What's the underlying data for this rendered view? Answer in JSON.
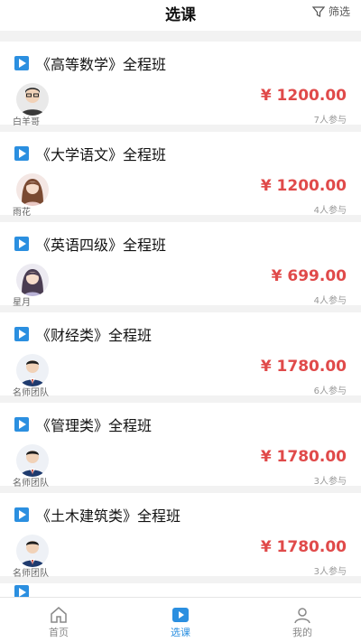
{
  "header": {
    "title": "选课",
    "filter_label": "筛选"
  },
  "courses": [
    {
      "title": "《高等数学》全程班",
      "teacher": "白羊哥",
      "price": "¥ 1200.00",
      "enrolled": "7人参与",
      "avatar": "male-glasses"
    },
    {
      "title": "《大学语文》全程班",
      "teacher": "雨花",
      "price": "¥ 1200.00",
      "enrolled": "4人参与",
      "avatar": "female-brown"
    },
    {
      "title": "《英语四级》全程班",
      "teacher": "星月",
      "price": "¥ 699.00",
      "enrolled": "4人参与",
      "avatar": "female-dark"
    },
    {
      "title": "《财经类》全程班",
      "teacher": "名师团队",
      "price": "¥ 1780.00",
      "enrolled": "6人参与",
      "avatar": "male-suit"
    },
    {
      "title": "《管理类》全程班",
      "teacher": "名师团队",
      "price": "¥ 1780.00",
      "enrolled": "3人参与",
      "avatar": "male-suit"
    },
    {
      "title": "《土木建筑类》全程班",
      "teacher": "名师团队",
      "price": "¥ 1780.00",
      "enrolled": "3人参与",
      "avatar": "male-suit"
    }
  ],
  "tabbar": {
    "home_label": "首页",
    "courses_label": "选课",
    "mine_label": "我的"
  },
  "colors": {
    "accent": "#2b8fe0",
    "price": "#e04a4a"
  }
}
